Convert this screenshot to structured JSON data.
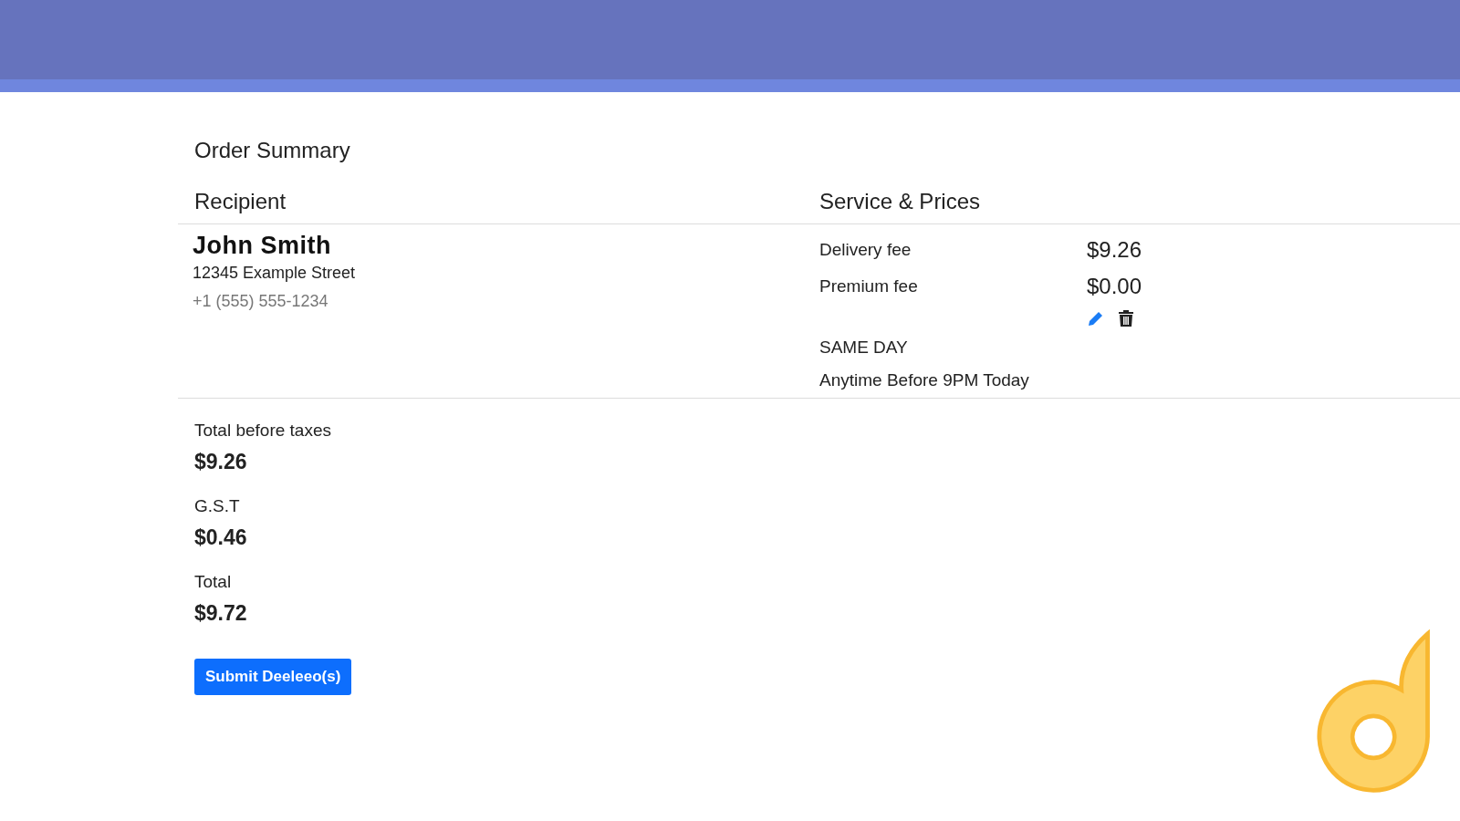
{
  "title": "Order Summary",
  "recipient": {
    "heading": "Recipient",
    "name": "John Smith",
    "address": "12345 Example Street",
    "phone": "+1 (555) 555-1234"
  },
  "service": {
    "heading": "Service & Prices",
    "fees": [
      {
        "label": "Delivery fee",
        "amount": "$9.26"
      },
      {
        "label": "Premium fee",
        "amount": "$0.00"
      }
    ],
    "speed": "SAME DAY",
    "window": "Anytime Before 9PM Today"
  },
  "totals": [
    {
      "label": "Total before taxes",
      "amount": "$9.26"
    },
    {
      "label": "G.S.T",
      "amount": "$0.46"
    },
    {
      "label": "Total",
      "amount": "$9.72"
    }
  ],
  "submit_button": "Submit Deeleeo(s)"
}
